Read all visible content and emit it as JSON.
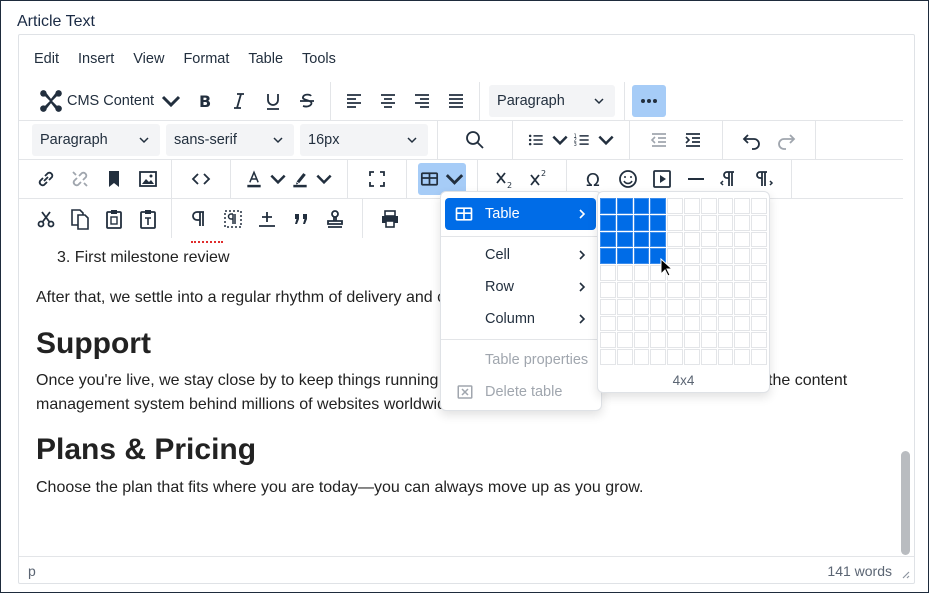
{
  "field_label": "Article Text",
  "menubar": [
    "Edit",
    "Insert",
    "View",
    "Format",
    "Table",
    "Tools"
  ],
  "toolbar": {
    "cms_content": "CMS Content",
    "block_format": "Paragraph",
    "font_block": "Paragraph",
    "font_family": "sans-serif",
    "font_size": "16px"
  },
  "content": {
    "list_item_number": "3.",
    "list_item_text": "First milestone review",
    "para1": "After that, we settle into a regular rhythm of delivery and c",
    "heading_support": "Support",
    "para2_line1_start": "Once you're live, we stay close by to keep things running",
    "para2_line1_end": "the content",
    "para2_line2": "management system behind millions of websites worldwid",
    "heading_plans": "Plans & Pricing",
    "para3": "Choose the plan that fits where you are today—you can always move up as you grow."
  },
  "status": {
    "path": "p",
    "word_count": "141 words"
  },
  "table_menu": {
    "table": "Table",
    "cell": "Cell",
    "row": "Row",
    "column": "Column",
    "table_properties": "Table properties",
    "delete_table": "Delete table"
  },
  "table_grid": {
    "selection_label": "4x4",
    "columns": 10,
    "rows": 10,
    "selected_cols": 4,
    "selected_rows": 4
  },
  "colors": {
    "accent": "#006ce7",
    "active_button": "#a6ccf7",
    "text": "#222f3e",
    "spellcheck": "#e02d2d"
  }
}
